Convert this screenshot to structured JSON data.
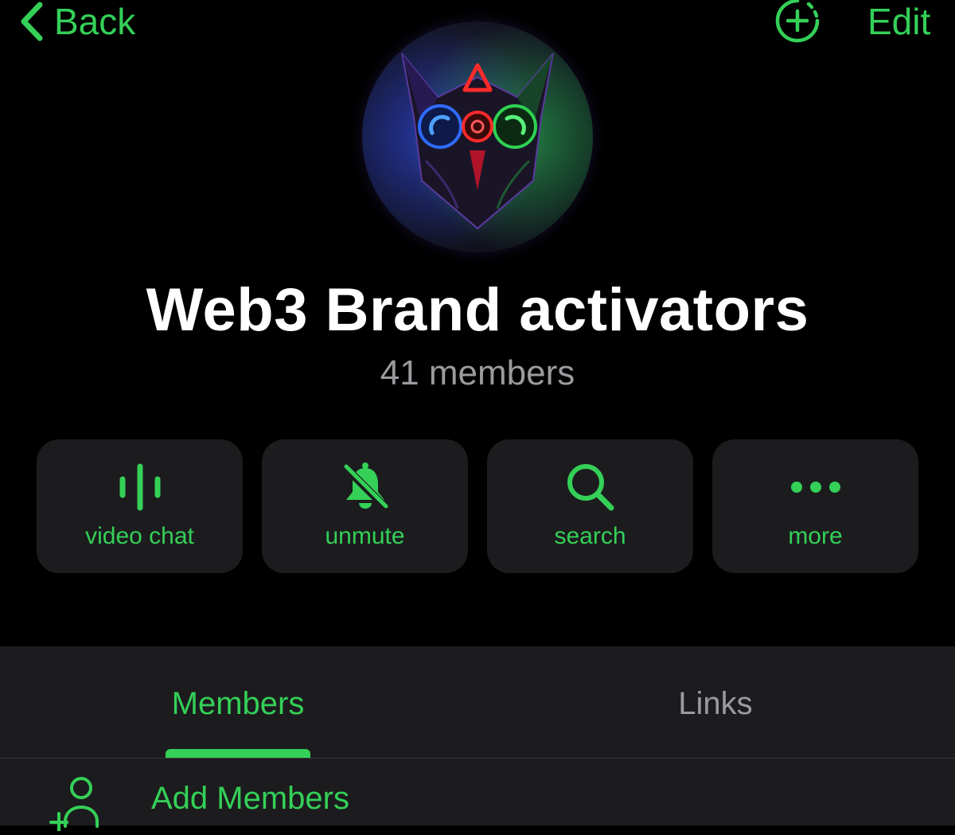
{
  "colors": {
    "accent": "#34d058",
    "background": "#000000",
    "surface": "#1c1c1e",
    "secondary_text": "#9b9b9f"
  },
  "header": {
    "back_label": "Back",
    "back_icon": "chevron-left-icon",
    "add_story_icon": "add-story-circle-icon",
    "edit_label": "Edit"
  },
  "profile": {
    "avatar": "owl-avatar",
    "title": "Web3 Brand activators",
    "subtitle": "41 members"
  },
  "actions": [
    {
      "icon": "voice-chat-bars-icon",
      "label": "video chat"
    },
    {
      "icon": "bell-slash-icon",
      "label": "unmute"
    },
    {
      "icon": "search-icon",
      "label": "search"
    },
    {
      "icon": "more-dots-icon",
      "label": "more"
    }
  ],
  "tabs": [
    {
      "label": "Members",
      "active": true
    },
    {
      "label": "Links",
      "active": false
    }
  ],
  "members": {
    "add_label": "Add Members",
    "add_icon": "add-person-icon"
  }
}
